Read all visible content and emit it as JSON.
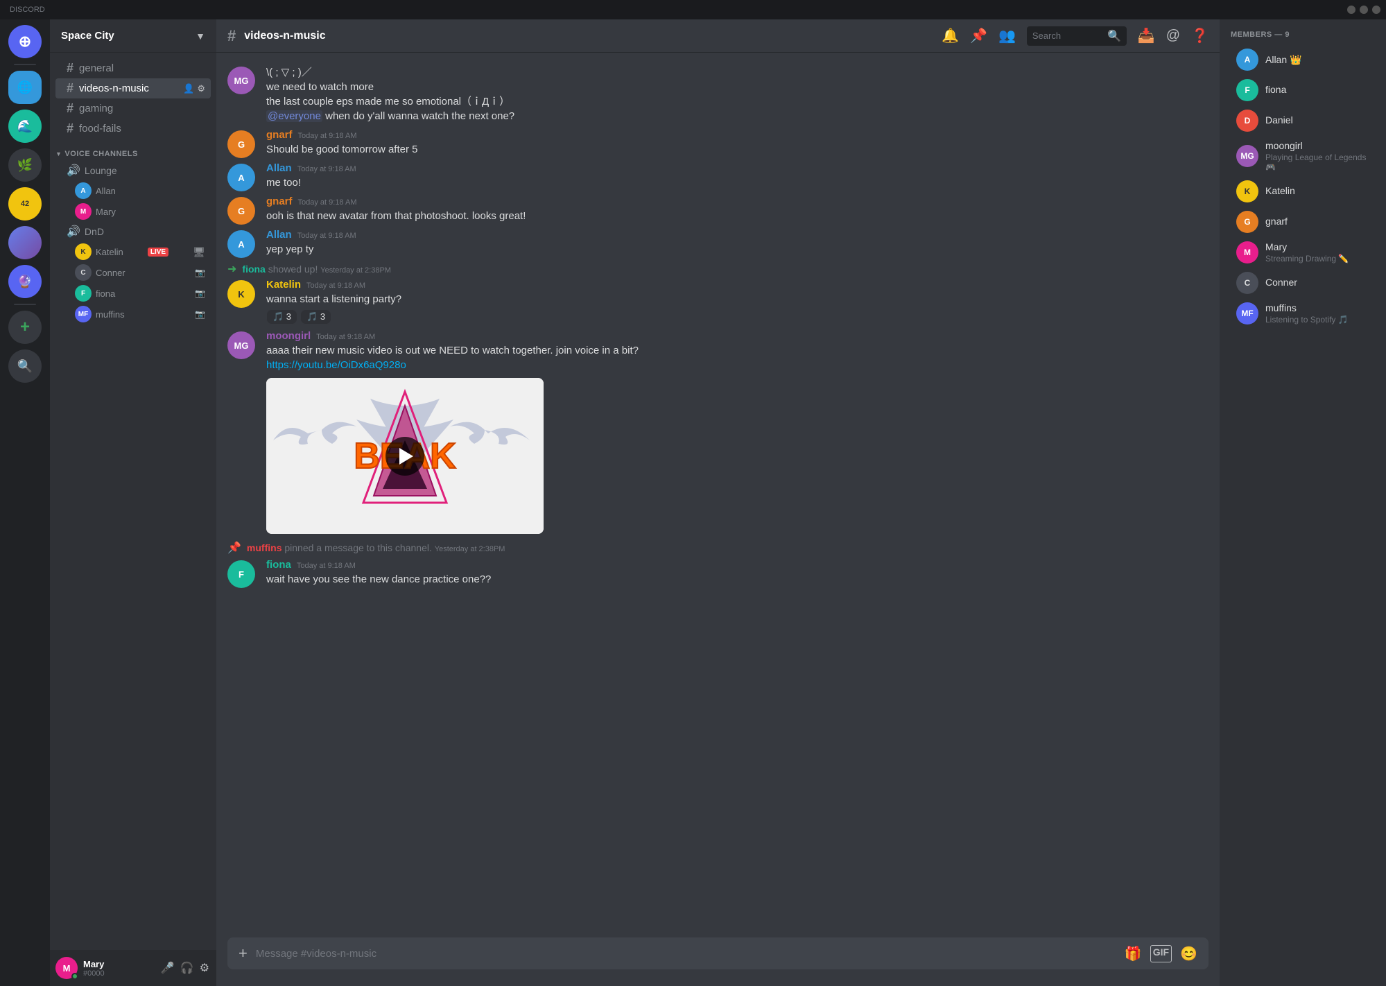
{
  "titleBar": {
    "appName": "DISCORD",
    "controls": [
      "minimize",
      "maximize",
      "close"
    ]
  },
  "serverSidebar": {
    "servers": [
      {
        "id": "discord",
        "label": "Discord",
        "icon": "⊕",
        "colorClass": "discord-logo"
      },
      {
        "id": "s1",
        "label": "Planet",
        "colorClass": "blue"
      },
      {
        "id": "s2",
        "label": "Teal",
        "colorClass": "teal"
      },
      {
        "id": "s3",
        "label": "Green",
        "colorClass": "green"
      },
      {
        "id": "s4",
        "label": "Gold",
        "colorClass": "yellow"
      },
      {
        "id": "s5",
        "label": "Gradient",
        "colorClass": "gradient"
      },
      {
        "id": "s6",
        "label": "Purple",
        "colorClass": "purple"
      }
    ],
    "addServer": "+",
    "discoverServers": "🔍"
  },
  "channelSidebar": {
    "serverName": "Space City",
    "textChannels": [
      {
        "id": "general",
        "name": "general",
        "active": false
      },
      {
        "id": "videos-n-music",
        "name": "videos-n-music",
        "active": true
      },
      {
        "id": "gaming",
        "name": "gaming",
        "active": false
      },
      {
        "id": "food-fails",
        "name": "food-fails",
        "active": false
      }
    ],
    "voiceSection": "VOICE CHANNELS",
    "voiceChannels": [
      {
        "id": "lounge",
        "name": "Lounge",
        "users": [
          {
            "name": "Allan",
            "colorClass": "av-blue"
          },
          {
            "name": "Mary",
            "colorClass": "av-pink"
          }
        ]
      },
      {
        "id": "dnd",
        "name": "DnD",
        "users": [
          {
            "name": "Katelin",
            "colorClass": "av-purple",
            "live": true
          },
          {
            "name": "Conner",
            "colorClass": "av-dark"
          },
          {
            "name": "fiona",
            "colorClass": "av-teal"
          },
          {
            "name": "muffins",
            "colorClass": "av-orange"
          }
        ]
      }
    ]
  },
  "userPanel": {
    "username": "Mary",
    "tag": "#0000",
    "avatarColor": "av-pink",
    "avatarInitial": "M"
  },
  "channelHeader": {
    "channelName": "videos-n-music",
    "searchPlaceholder": "Search"
  },
  "members": {
    "header": "MEMBERS — 9",
    "list": [
      {
        "name": "Allan",
        "hasCrown": true,
        "colorClass": "av-blue",
        "initial": "A"
      },
      {
        "name": "fiona",
        "hasCrown": false,
        "colorClass": "av-teal",
        "initial": "F"
      },
      {
        "name": "Daniel",
        "hasCrown": false,
        "colorClass": "av-red",
        "initial": "D"
      },
      {
        "name": "moongirl",
        "hasCrown": false,
        "colorClass": "av-purple",
        "initial": "MG",
        "status": "Playing League of Legends"
      },
      {
        "name": "Katelin",
        "hasCrown": false,
        "colorClass": "av-yellow",
        "initial": "K"
      },
      {
        "name": "gnarf",
        "hasCrown": false,
        "colorClass": "av-orange",
        "initial": "G"
      },
      {
        "name": "Mary",
        "hasCrown": false,
        "colorClass": "av-pink",
        "initial": "M",
        "status": "Streaming Drawing ✏️"
      },
      {
        "name": "Conner",
        "hasCrown": false,
        "colorClass": "av-dark",
        "initial": "C"
      },
      {
        "name": "muffins",
        "hasCrown": false,
        "colorClass": "av-indigo",
        "initial": "MF",
        "status": "Listening to Spotify"
      }
    ]
  },
  "messages": [
    {
      "id": "m1",
      "type": "continuation",
      "lines": [
        "\\( ; ▽ ; )／",
        "we need to watch more",
        "the last couple eps made me so emotional（ｉДｉ）",
        "@everyone when do y'all wanna watch the next one?"
      ],
      "colorClass": "av-pink",
      "initial": "MG"
    },
    {
      "id": "m2",
      "type": "message",
      "author": "gnarf",
      "authorColor": "#e67e22",
      "timestamp": "Today at 9:18 AM",
      "text": "Should be good tomorrow after 5",
      "colorClass": "av-orange",
      "initial": "G"
    },
    {
      "id": "m3",
      "type": "message",
      "author": "Allan",
      "authorColor": "#3498db",
      "timestamp": "Today at 9:18 AM",
      "text": "me too!",
      "colorClass": "av-blue",
      "initial": "A"
    },
    {
      "id": "m4",
      "type": "message",
      "author": "gnarf",
      "authorColor": "#e67e22",
      "timestamp": "Today at 9:18 AM",
      "text": "ooh is that new avatar from that photoshoot. looks great!",
      "colorClass": "av-orange",
      "initial": "G"
    },
    {
      "id": "m5",
      "type": "message",
      "author": "Allan",
      "authorColor": "#3498db",
      "timestamp": "Today at 9:18 AM",
      "text": "yep yep ty",
      "colorClass": "av-blue",
      "initial": "A"
    },
    {
      "id": "m6",
      "type": "system",
      "text": "fiona showed up!",
      "timestamp": "Yesterday at 2:38PM"
    },
    {
      "id": "m7",
      "type": "message",
      "author": "Katelin",
      "authorColor": "#f1c40f",
      "timestamp": "Today at 9:18 AM",
      "text": "wanna start a listening party?",
      "colorClass": "av-yellow",
      "initial": "K",
      "reactions": [
        {
          "emoji": "🎵",
          "count": 3
        },
        {
          "emoji": "🎵",
          "count": 3
        }
      ]
    },
    {
      "id": "m8",
      "type": "message",
      "author": "moongirl",
      "authorColor": "#9b59b6",
      "timestamp": "Today at 9:18 AM",
      "text": "aaaa their new music video is out we NEED to watch together. join voice in a bit?",
      "link": "https://youtu.be/OiDx6aQ928o",
      "hasVideo": true,
      "colorClass": "av-purple",
      "initial": "MG"
    },
    {
      "id": "m9",
      "type": "pin",
      "pinner": "muffins",
      "text": "pinned a message to this channel.",
      "timestamp": "Yesterday at 2:38PM"
    },
    {
      "id": "m10",
      "type": "message",
      "author": "fiona",
      "authorColor": "#1abc9c",
      "timestamp": "Today at 9:18 AM",
      "text": "wait have you see the new dance practice one??",
      "colorClass": "av-teal",
      "initial": "F"
    }
  ],
  "messageInput": {
    "placeholder": "Message #videos-n-music"
  }
}
